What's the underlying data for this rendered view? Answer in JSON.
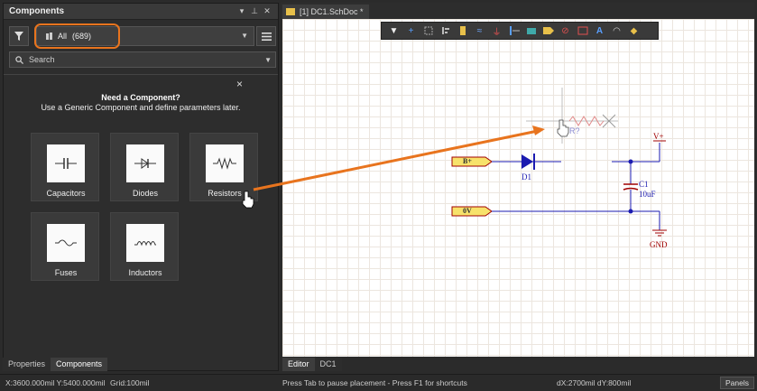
{
  "panel": {
    "title": "Components",
    "header_icons": [
      "▾",
      "⊥",
      "✕"
    ],
    "library": {
      "label": "All",
      "count": "(689)"
    },
    "search_placeholder": "Search",
    "close_hint": "×",
    "need_title": "Need a Component?",
    "need_desc": "Use a Generic Component and define parameters later.",
    "tiles": [
      {
        "label": "Capacitors",
        "icon": "capacitor-icon"
      },
      {
        "label": "Diodes",
        "icon": "diode-icon"
      },
      {
        "label": "Resistors",
        "icon": "resistor-icon"
      },
      {
        "label": "Fuses",
        "icon": "fuse-icon"
      },
      {
        "label": "Inductors",
        "icon": "inductor-icon"
      }
    ],
    "tabs": [
      "Properties",
      "Components"
    ]
  },
  "document": {
    "tab_label": "[1] DC1.SchDoc *"
  },
  "editor": {
    "tabs": [
      "Editor",
      "DC1"
    ],
    "schematic": {
      "net_b_plus": "B+",
      "net_0v": "0V",
      "diode": "D1",
      "capacitor": "C1",
      "capacitor_value": "10uF",
      "power": "V+",
      "ground": "GND",
      "ghost_resistor": "R?"
    }
  },
  "status": {
    "coords": "X:3600.000mil Y:5400.000mil",
    "grid": "Grid:100mil",
    "message": "Press Tab to pause placement - Press F1 for shortcuts",
    "delta": "dX:2700mil dY:800mil",
    "panels": "Panels"
  },
  "colors": {
    "accent_orange": "#e8741e",
    "wire_blue": "#1b1bb0",
    "component_red": "#a00000"
  }
}
